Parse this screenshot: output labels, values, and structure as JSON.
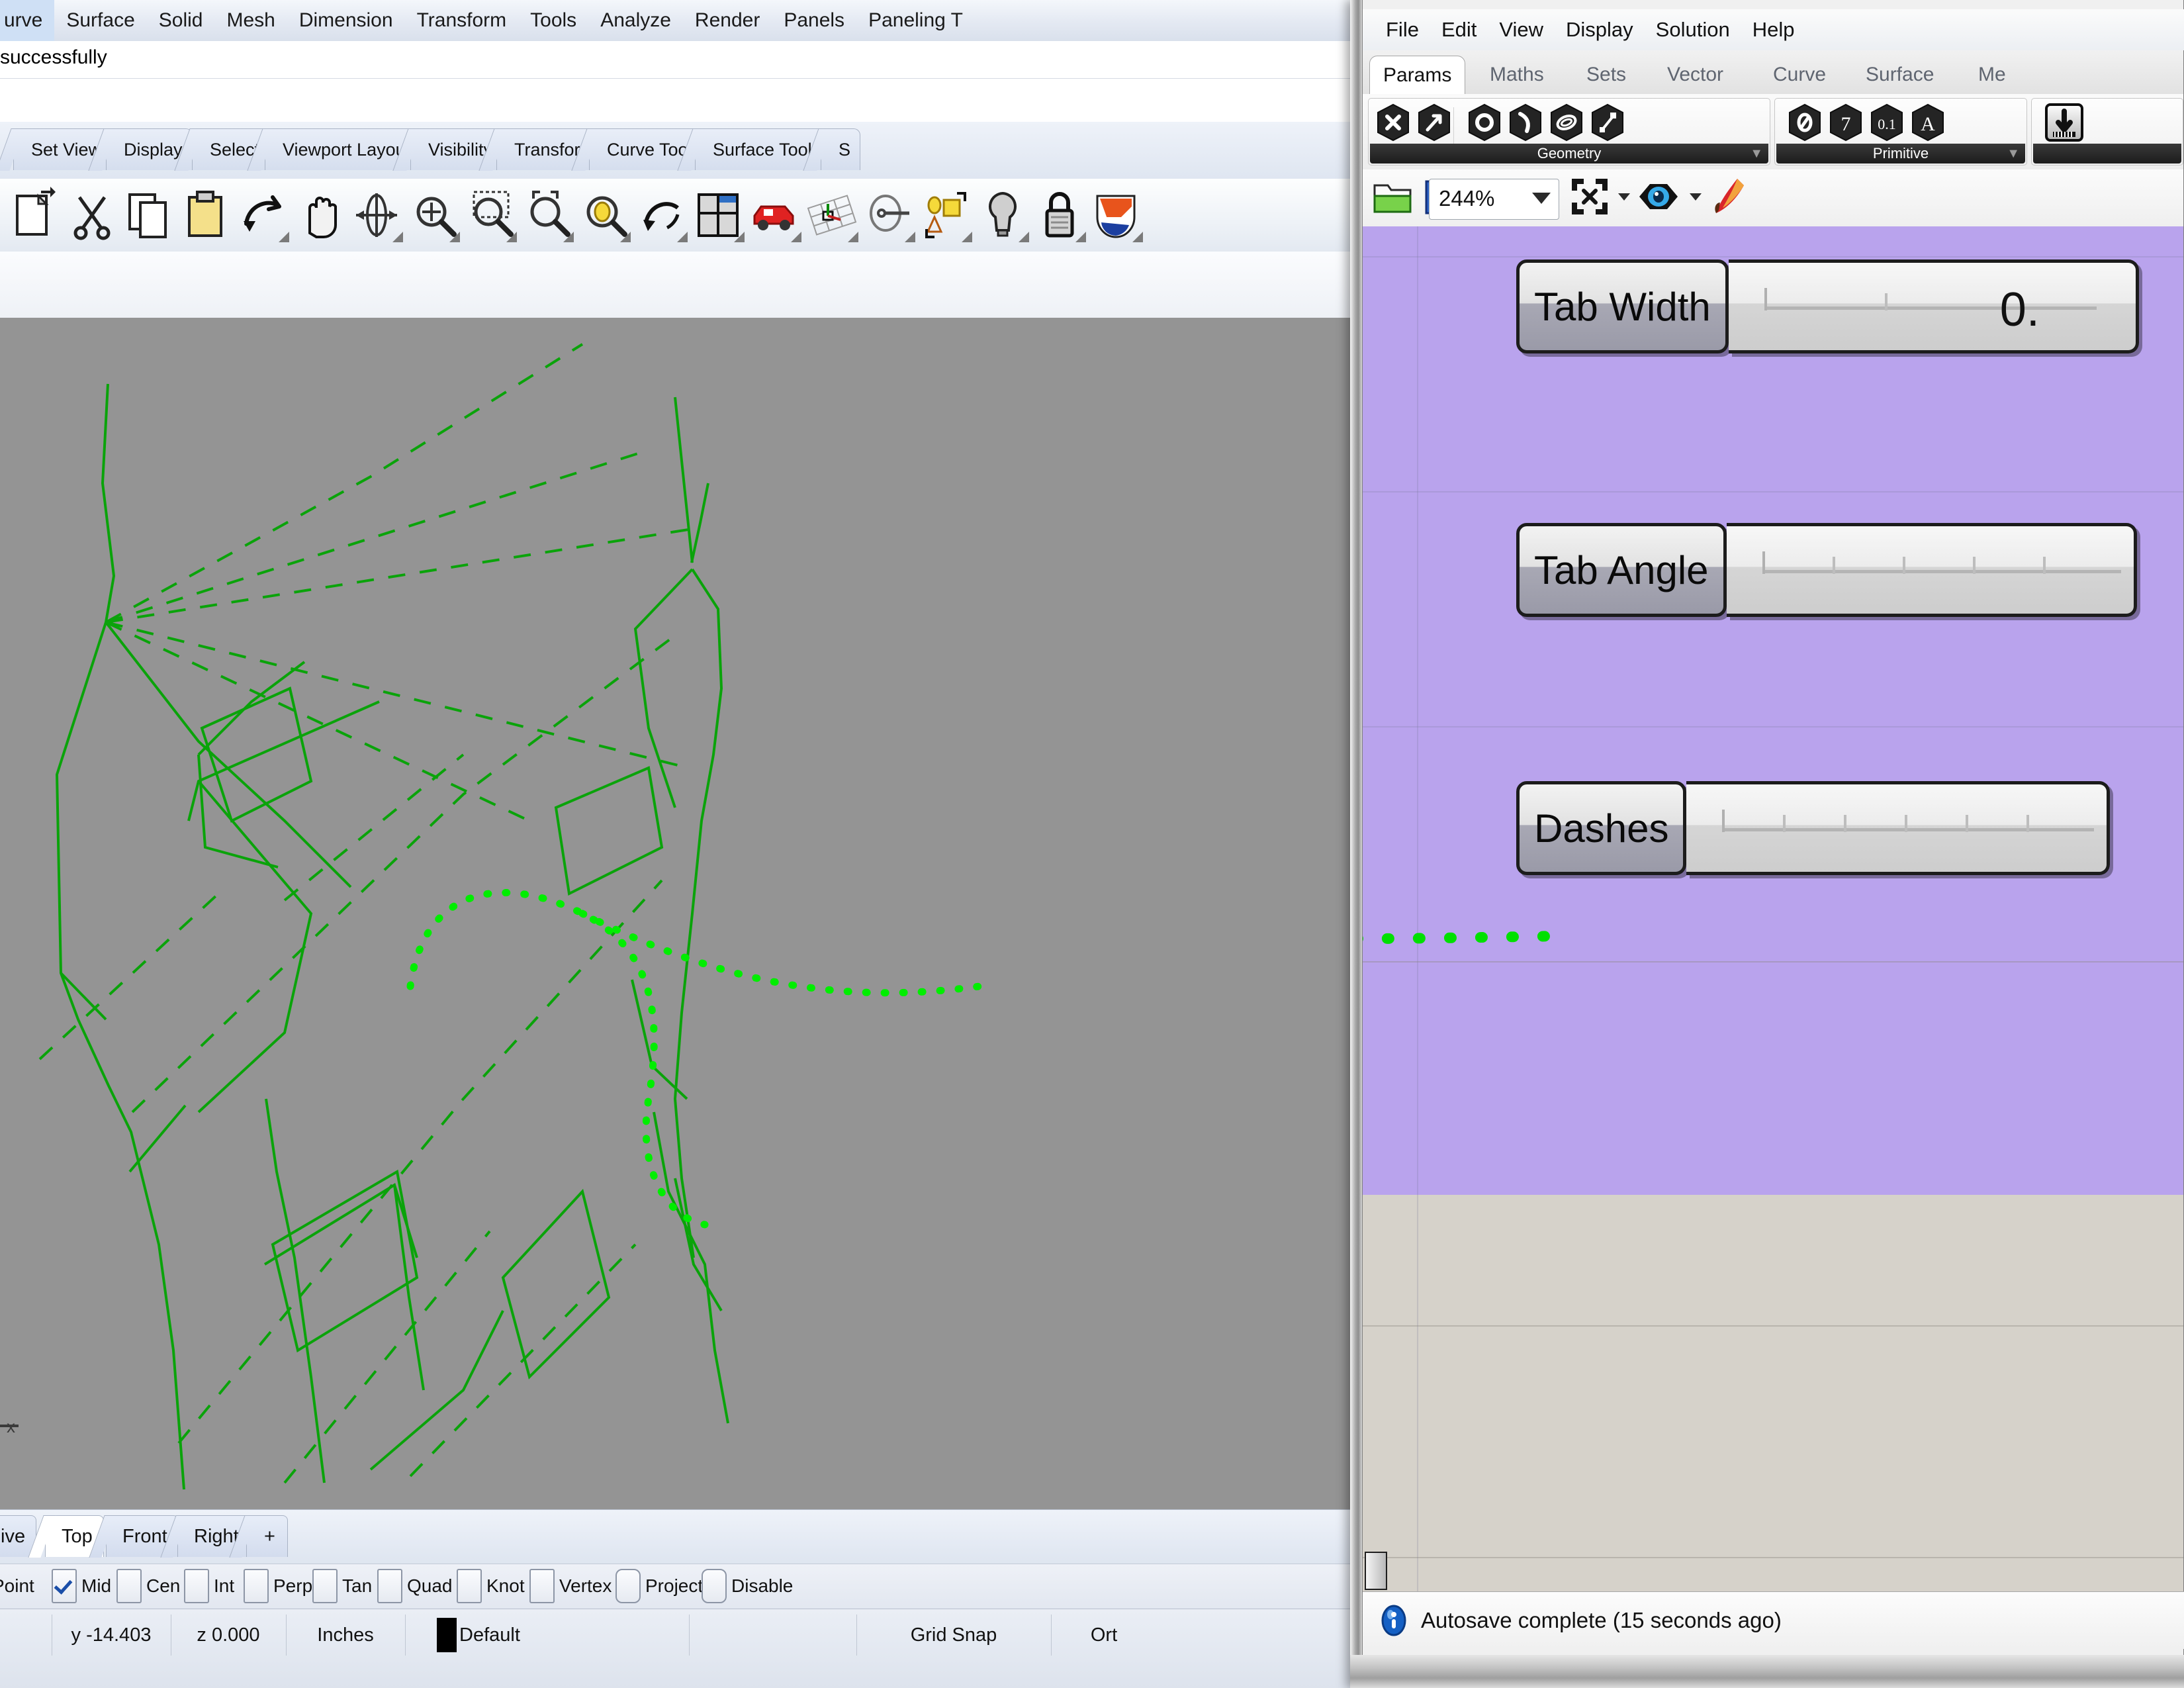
{
  "rhino": {
    "menubar": [
      "urve",
      "Surface",
      "Solid",
      "Mesh",
      "Dimension",
      "Transform",
      "Tools",
      "Analyze",
      "Render",
      "Panels",
      "Paneling T"
    ],
    "command_line": "successfully",
    "toolbar_tabs": [
      "Set View",
      "Display",
      "Select",
      "Viewport Layout",
      "Visibility",
      "Transform",
      "Curve Tools",
      "Surface Tools",
      "S"
    ],
    "toolbar_icons": [
      {
        "name": "new-file-icon",
        "label": "New"
      },
      {
        "name": "cut-scissors-icon",
        "label": "Cut"
      },
      {
        "name": "copy-icon",
        "label": "Copy"
      },
      {
        "name": "paste-icon",
        "label": "Paste"
      },
      {
        "name": "undo-arrow-icon",
        "label": "Undo"
      },
      {
        "name": "pan-hand-icon",
        "label": "Pan"
      },
      {
        "name": "rotate-view-icon",
        "label": "Rotate View"
      },
      {
        "name": "zoom-target-icon",
        "label": "Zoom Target"
      },
      {
        "name": "zoom-window-icon",
        "label": "Zoom Window"
      },
      {
        "name": "zoom-extents-icon",
        "label": "Zoom Extents"
      },
      {
        "name": "zoom-selected-icon",
        "label": "Zoom Selected"
      },
      {
        "name": "undo-view-icon",
        "label": "Undo View Change"
      },
      {
        "name": "viewport-layout-icon",
        "label": "4 Viewport Layout"
      },
      {
        "name": "render-car-icon",
        "label": "Render"
      },
      {
        "name": "cplane-grid-icon",
        "label": "Set CPlane"
      },
      {
        "name": "camera-icon",
        "label": "Camera"
      },
      {
        "name": "object-properties-icon",
        "label": "Properties"
      },
      {
        "name": "light-bulb-icon",
        "label": "Light"
      },
      {
        "name": "lock-icon",
        "label": "Lock"
      },
      {
        "name": "shield-icon",
        "label": "Layers"
      }
    ],
    "viewport_tabs": [
      {
        "label": "ive",
        "active": false
      },
      {
        "label": "Top",
        "active": true
      },
      {
        "label": "Front",
        "active": false
      },
      {
        "label": "Right",
        "active": false
      },
      {
        "label": "+",
        "active": false
      }
    ],
    "osnap": [
      {
        "label": "Point",
        "checked": false,
        "nobox": true
      },
      {
        "label": "Mid",
        "checked": true,
        "nobox": false
      },
      {
        "label": "Cen",
        "checked": false,
        "nobox": false
      },
      {
        "label": "Int",
        "checked": false,
        "nobox": false
      },
      {
        "label": "Perp",
        "checked": false,
        "nobox": false
      },
      {
        "label": "Tan",
        "checked": false,
        "nobox": false
      },
      {
        "label": "Quad",
        "checked": false,
        "nobox": false
      },
      {
        "label": "Knot",
        "checked": false,
        "nobox": false
      },
      {
        "label": "Vertex",
        "checked": false,
        "nobox": false
      },
      {
        "label": "Project",
        "checked": false,
        "nobox": false
      },
      {
        "label": "Disable",
        "checked": false,
        "nobox": false
      }
    ],
    "statusbar": {
      "y": "y -14.403",
      "z": "z 0.000",
      "units": "Inches",
      "layer": "Default",
      "grid_snap": "Grid Snap",
      "ortho": "Ort"
    },
    "axis_label": "x"
  },
  "grasshopper": {
    "menubar": [
      "File",
      "Edit",
      "View",
      "Display",
      "Solution",
      "Help"
    ],
    "tabs": [
      {
        "label": "Params",
        "active": true
      },
      {
        "label": "Maths",
        "active": false
      },
      {
        "label": "Sets",
        "active": false
      },
      {
        "label": "Vector",
        "active": false
      },
      {
        "label": "Curve",
        "active": false
      },
      {
        "label": "Surface",
        "active": false
      },
      {
        "label": "Me",
        "active": false
      }
    ],
    "ribbon_groups": [
      {
        "caption": "Geometry",
        "icons": [
          "param-cross-icon",
          "param-arrow-icon",
          "param-circle-icon",
          "param-curve-icon",
          "param-surface-icon",
          "param-line-icon"
        ]
      },
      {
        "caption": "Primitive",
        "icons": [
          "param-slash-icon",
          "param-seven-icon",
          "param-number-icon",
          "param-letter-a-icon"
        ]
      },
      {
        "caption": "",
        "icons": [
          "param-import-icon"
        ]
      }
    ],
    "canvas_toolbar": {
      "open_icon": "open-folder-icon",
      "save_icon": "save-floppy-icon",
      "zoom_level": "244%",
      "zoom_extents_icon": "zoom-extents-icon",
      "preview_icon": "eye-preview-icon",
      "paint_icon": "paintbrush-icon"
    },
    "components": [
      {
        "name": "Tab Width",
        "slider_value": "0.",
        "ticks": 2
      },
      {
        "name": "Tab Angle",
        "slider_value": "",
        "ticks": 5
      },
      {
        "name": "Dashes",
        "slider_value": "",
        "ticks": 6
      }
    ],
    "status": {
      "icon": "info-circle-icon",
      "text": "Autosave complete (15 seconds ago)"
    },
    "colors": {
      "group_purple": "#b9a3ed",
      "canvas_beige": "#d6d2ca",
      "wire_green": "#00e000"
    }
  }
}
